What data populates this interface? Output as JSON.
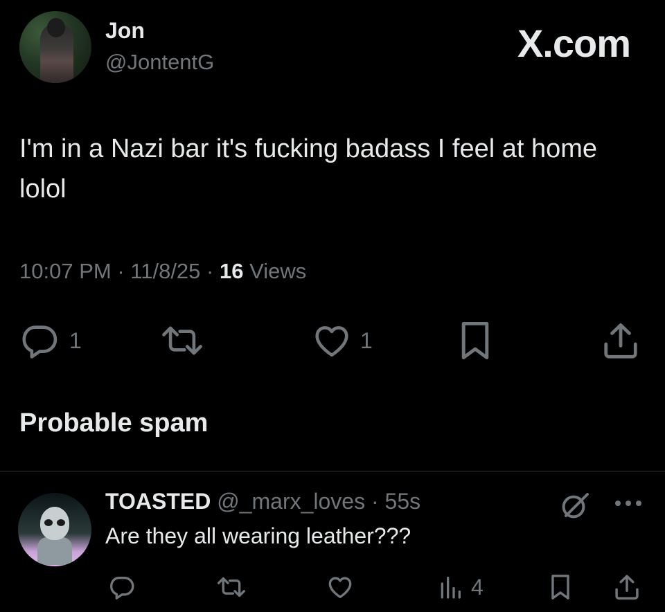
{
  "post": {
    "author_name": "Jon",
    "author_handle": "@JontentG",
    "brand": "X.com",
    "text": "I'm in a Nazi bar it's fucking badass I feel at home lolol",
    "time": "10:07 PM",
    "date": "11/8/25",
    "separator": "·",
    "views_count": "16",
    "views_label": "Views",
    "reply_count": "1",
    "like_count": "1"
  },
  "notice": {
    "spam_label": "Probable spam"
  },
  "reply": {
    "name": "TOASTED",
    "handle": "@_marx_loves",
    "separator": "·",
    "age": "55s",
    "text": "Are they all wearing leather???",
    "views_count": "4"
  },
  "icons": {
    "reply": "reply-icon",
    "repost": "repost-icon",
    "like": "heart-icon",
    "bookmark": "bookmark-icon",
    "share": "share-icon",
    "views": "views-icon",
    "grok": "grok-icon",
    "more": "more-icon"
  },
  "colors": {
    "background": "#000000",
    "text_primary": "#e7e9ea",
    "text_secondary": "#71767b",
    "divider": "#2f3336"
  }
}
